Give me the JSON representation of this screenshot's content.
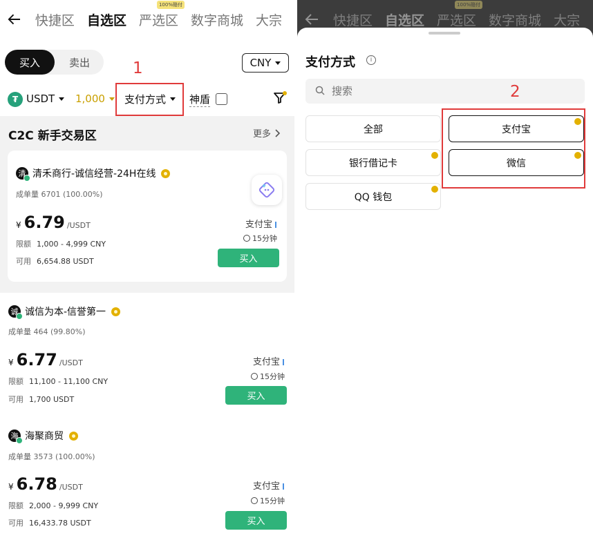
{
  "left": {
    "nav": {
      "tabs": [
        "快捷区",
        "自选区",
        "严选区",
        "数字商城",
        "大宗"
      ],
      "active_index": 1,
      "badge": "100%赔付"
    },
    "trade_toggle": {
      "buy": "买入",
      "sell": "卖出"
    },
    "currency": "CNY",
    "filters": {
      "asset": "USDT",
      "amount": "1,000",
      "payment": "支付方式",
      "shield": "神盾"
    },
    "annotation": "1",
    "section": {
      "title": "C2C 新手交易区",
      "more": "更多"
    },
    "ads": [
      {
        "avatar": "清",
        "name": "清禾商行-诚信经营-24H在线",
        "orders_label": "成单量",
        "orders": "6701 (100.00%)",
        "currency_symbol": "¥",
        "price": "6.79",
        "unit": "/USDT",
        "limit_label": "限额",
        "limit": "1,000 - 4,999 CNY",
        "avail_label": "可用",
        "available": "6,654.88 USDT",
        "payment": "支付宝",
        "time": "15分钟",
        "button": "买入"
      },
      {
        "avatar": "诚",
        "name": "诚信为本-信誉第一",
        "orders_label": "成单量",
        "orders": "464 (99.80%)",
        "currency_symbol": "¥",
        "price": "6.77",
        "unit": "/USDT",
        "limit_label": "限额",
        "limit": "11,100 - 11,100 CNY",
        "avail_label": "可用",
        "available": "1,700 USDT",
        "payment": "支付宝",
        "time": "15分钟",
        "button": "买入"
      },
      {
        "avatar": "海",
        "name": "海聚商贸",
        "orders_label": "成单量",
        "orders": "3573 (100.00%)",
        "currency_symbol": "¥",
        "price": "6.78",
        "unit": "/USDT",
        "limit_label": "限额",
        "limit": "2,000 - 9,999 CNY",
        "avail_label": "可用",
        "available": "16,433.78 USDT",
        "payment": "支付宝",
        "time": "15分钟",
        "button": "买入"
      }
    ]
  },
  "right": {
    "nav": {
      "tabs": [
        "快捷区",
        "自选区",
        "严选区",
        "数字商城",
        "大宗"
      ],
      "badge": "100%赔付"
    },
    "sheet": {
      "title": "支付方式",
      "search_placeholder": "搜索",
      "annotation": "2",
      "options": [
        {
          "label": "全部",
          "selected": false
        },
        {
          "label": "支付宝",
          "selected": true
        },
        {
          "label": "银行借记卡",
          "selected": false
        },
        {
          "label": "微信",
          "selected": true
        },
        {
          "label": "QQ 钱包",
          "selected": false
        }
      ]
    }
  },
  "colors": {
    "buy_green": "#2fb37a",
    "highlight_red": "#e03a3a",
    "amount_gold": "#c9a000"
  }
}
